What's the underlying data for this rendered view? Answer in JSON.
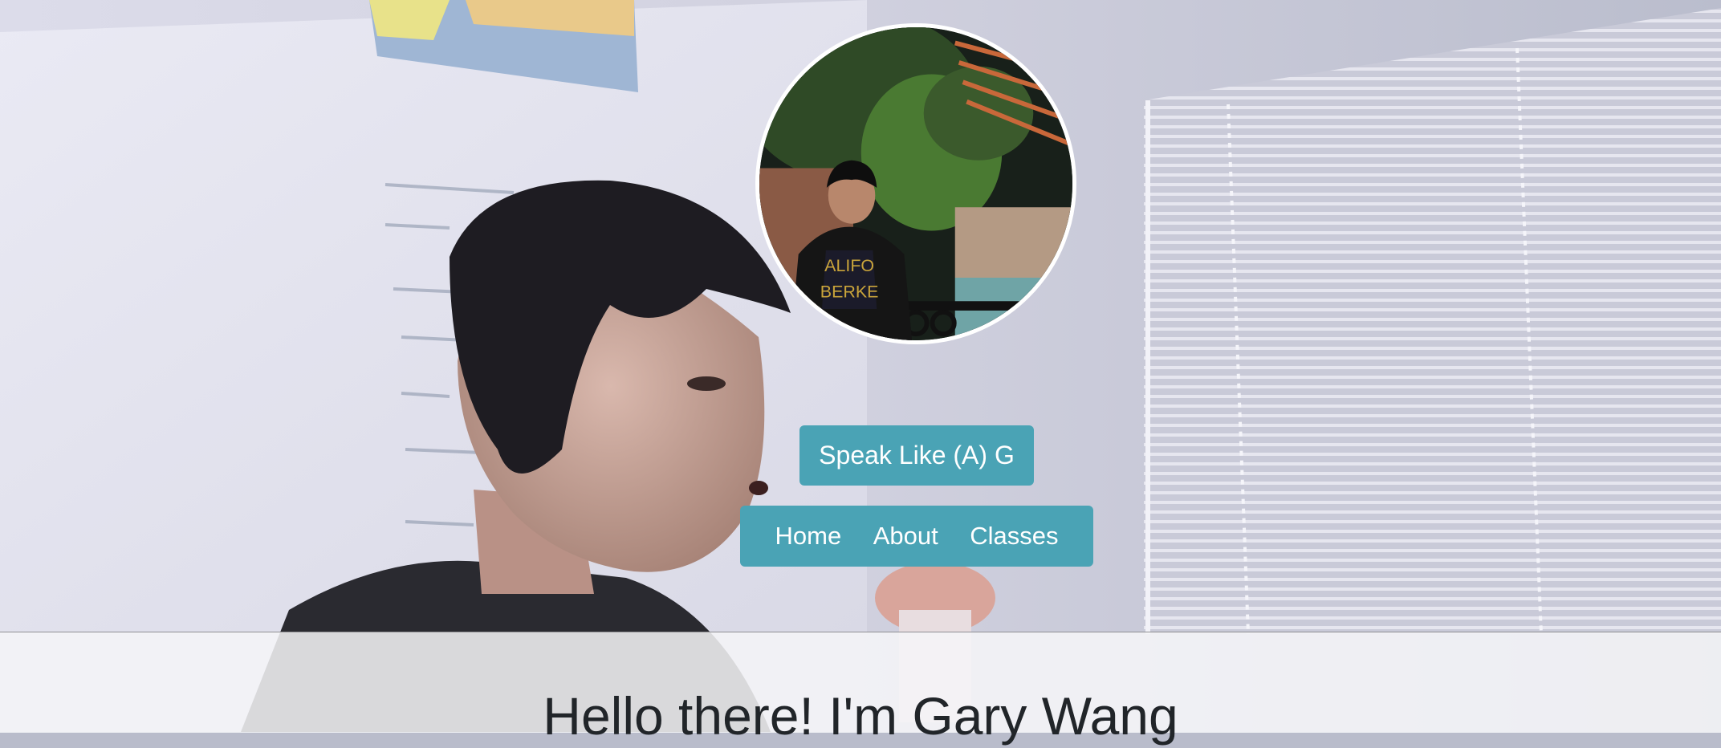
{
  "navbar": {
    "brand_label": "Speak Like (A) G",
    "items": [
      {
        "label": "Home"
      },
      {
        "label": "About"
      },
      {
        "label": "Classes"
      }
    ]
  },
  "hero": {
    "title": "Hello there! I'm Gary Wang"
  },
  "colors": {
    "accent": "#4aa3b5",
    "heading": "#212529",
    "content_panel": "#f6f6f8"
  },
  "icons": {
    "avatar": "profile-photo"
  }
}
